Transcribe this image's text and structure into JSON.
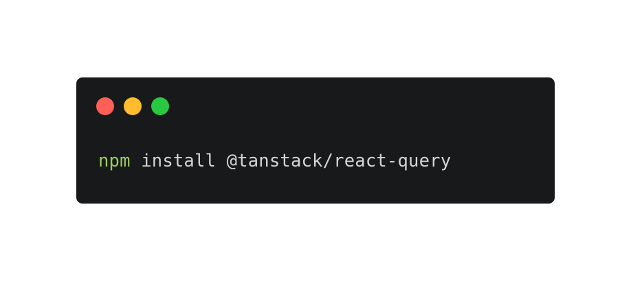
{
  "window": {
    "controls": {
      "close_color": "#ff5f57",
      "minimize_color": "#febc2e",
      "maximize_color": "#28c840"
    },
    "background_color": "#18191b"
  },
  "code": {
    "command": "npm",
    "command_color": "#9acd5a",
    "arguments": " install @tanstack/react-query",
    "arguments_color": "#d4d4d4"
  }
}
